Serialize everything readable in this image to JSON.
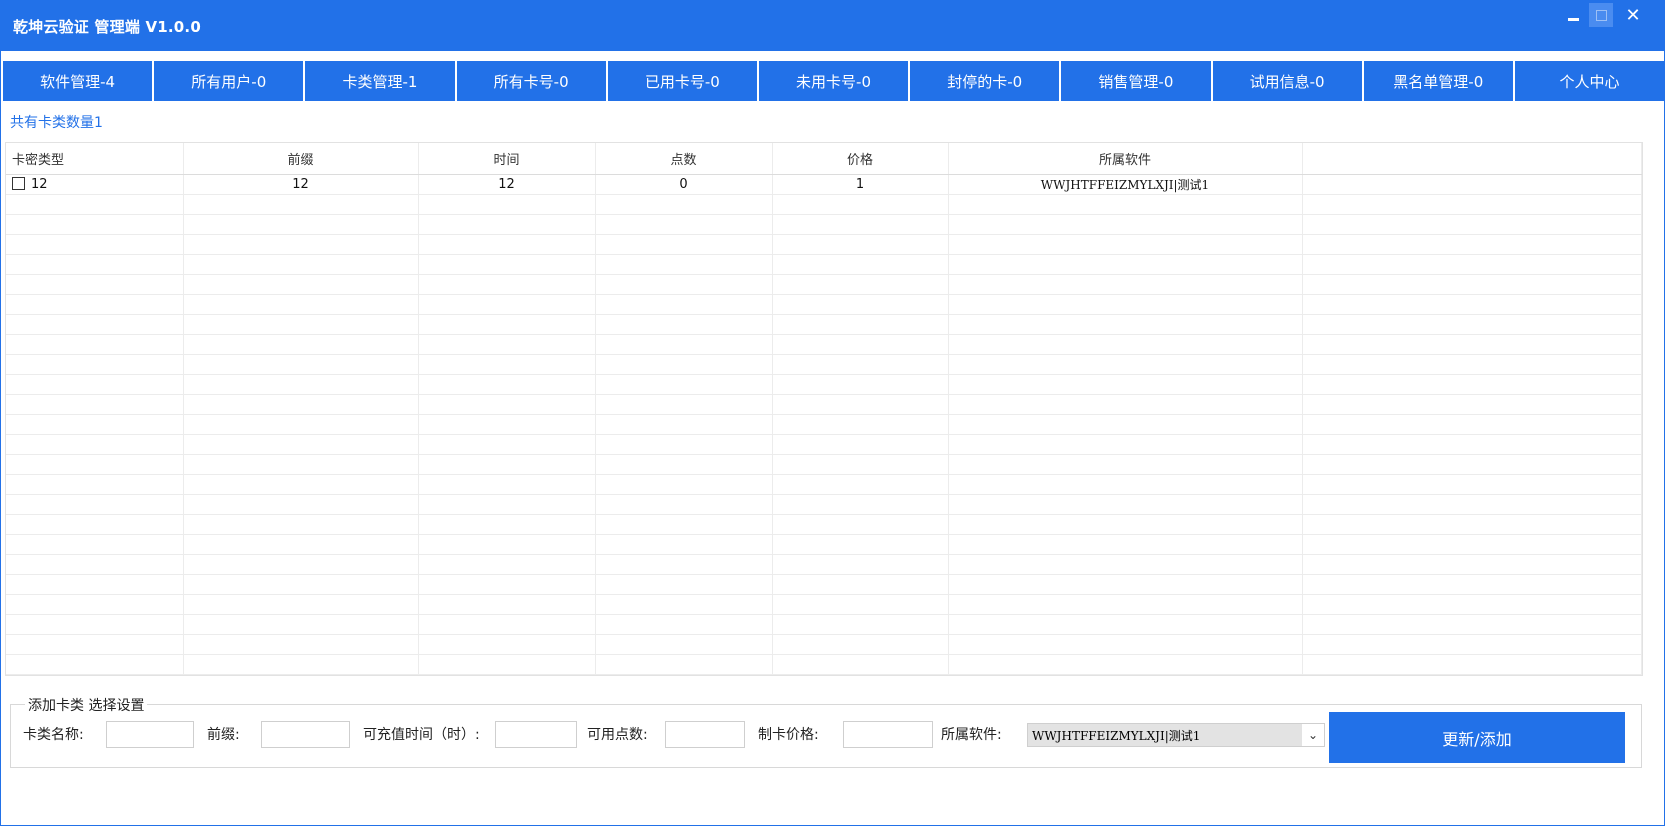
{
  "window": {
    "title": "乾坤云验证 管理端 V1.0.0",
    "buttons": {
      "minimize": "minimize-icon",
      "maximize": "maximize-icon",
      "close": "close-icon"
    }
  },
  "tabs": [
    {
      "label": "软件管理-4"
    },
    {
      "label": "所有用户-0"
    },
    {
      "label": "卡类管理-1"
    },
    {
      "label": "所有卡号-0"
    },
    {
      "label": "已用卡号-0"
    },
    {
      "label": "未用卡号-0"
    },
    {
      "label": "封停的卡-0"
    },
    {
      "label": "销售管理-0"
    },
    {
      "label": "试用信息-0"
    },
    {
      "label": "黑名单管理-0"
    },
    {
      "label": "个人中心"
    }
  ],
  "summary": "共有卡类数量1",
  "table": {
    "columns": [
      "卡密类型",
      "前缀",
      "时间",
      "点数",
      "价格",
      "所属软件",
      ""
    ],
    "rows": [
      [
        "12",
        "12",
        "12",
        "0",
        "1",
        "WWJHTFFEIZMYLXJI|测试1",
        ""
      ]
    ]
  },
  "form": {
    "group_title": "添加卡类 选择设置",
    "name_label": "卡类名称:",
    "name_value": "",
    "prefix_label": "前缀:",
    "prefix_value": "",
    "time_label": "可充值时间（时）:",
    "time_value": "",
    "points_label": "可用点数:",
    "points_value": "",
    "price_label": "制卡价格:",
    "price_value": "",
    "software_label": "所属软件:",
    "software_selected": "WWJHTFFEIZMYLXJI|测试1",
    "submit_label": "更新/添加"
  },
  "colors": {
    "accent": "#2271e8",
    "summary_text": "#2271e8"
  }
}
